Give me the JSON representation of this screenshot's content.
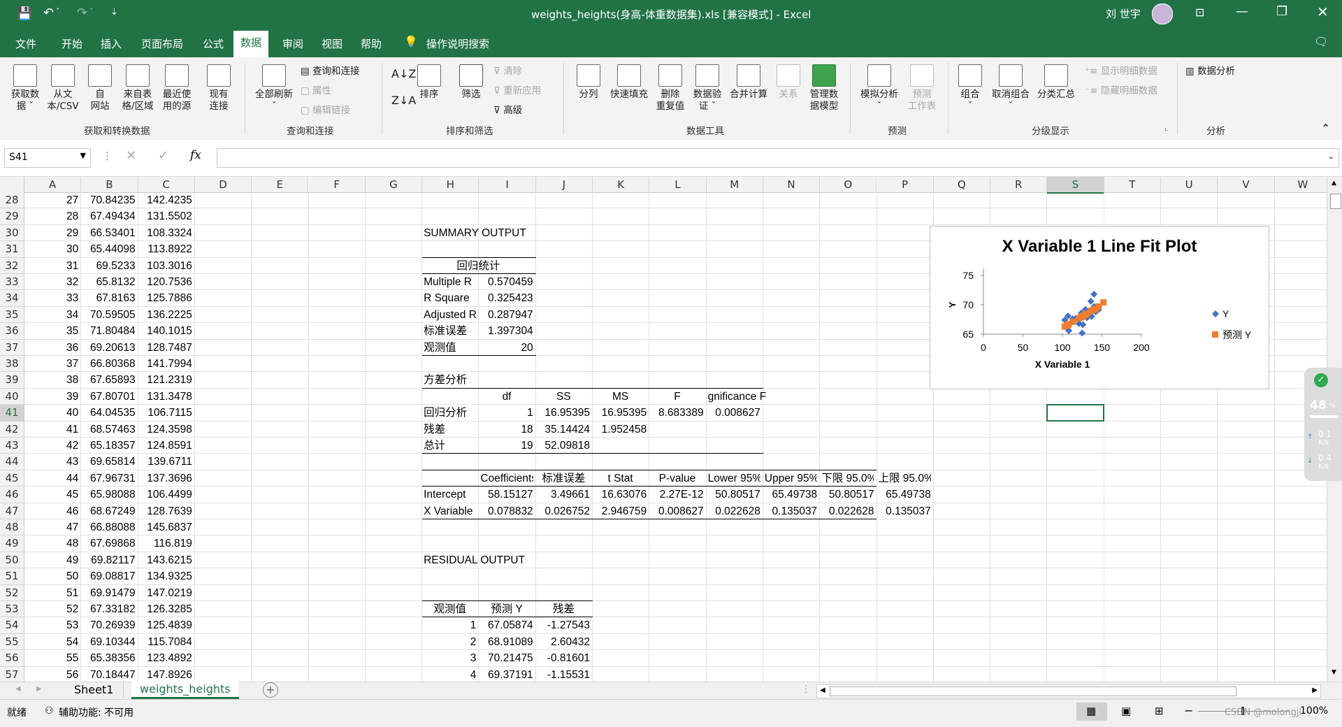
{
  "titlebar": {
    "title": "weights_heights(身高-体重数据集).xls  [兼容模式]  -  Excel",
    "user": "刘 世宇",
    "quick_more": "⇣"
  },
  "ribbon_tabs": [
    "文件",
    "开始",
    "插入",
    "页面布局",
    "公式",
    "数据",
    "审阅",
    "视图",
    "帮助"
  ],
  "active_tab": "数据",
  "tell_me": "操作说明搜索",
  "ribbon": {
    "get_data": [
      "获取数",
      "据 ˇ"
    ],
    "from_text": [
      "从文",
      "本/CSV"
    ],
    "from_web": [
      "自",
      "网站"
    ],
    "from_table": [
      "来自表",
      "格/区域"
    ],
    "recent": [
      "最近使",
      "用的源"
    ],
    "existing": [
      "现有",
      "连接"
    ],
    "group_get": "获取和转换数据",
    "refresh_all": [
      "全部刷新",
      "ˇ"
    ],
    "query_conn": "查询和连接",
    "properties": "属性",
    "edit_links": "编辑链接",
    "group_query": "查询和连接",
    "sort": "排序",
    "filter": "筛选",
    "clear": "清除",
    "reapply": "重新应用",
    "advanced": "高级",
    "group_sort": "排序和筛选",
    "text_to_col": "分列",
    "flash_fill": "快速填充",
    "remove_dup": [
      "删除",
      "重复值"
    ],
    "validation": [
      "数据验",
      "证 ˇ"
    ],
    "consolidate": "合并计算",
    "relations": "关系",
    "data_model": [
      "管理数",
      "据模型"
    ],
    "group_tools": "数据工具",
    "what_if": [
      "模拟分析",
      "ˇ"
    ],
    "forecast": [
      "预测",
      "工作表"
    ],
    "group_forecast": "预测",
    "group_btn": [
      "组合",
      "ˇ"
    ],
    "ungroup": [
      "取消组合",
      "ˇ"
    ],
    "subtotal": "分类汇总",
    "show_detail": "显示明细数据",
    "hide_detail": "隐藏明细数据",
    "group_outline": "分级显示",
    "data_analysis": "数据分析",
    "group_analysis": "分析"
  },
  "formula_bar": {
    "name_box": "S41",
    "fx": "fx",
    "value": ""
  },
  "columns": [
    "A",
    "B",
    "C",
    "D",
    "E",
    "F",
    "G",
    "H",
    "I",
    "J",
    "K",
    "L",
    "M",
    "N",
    "O",
    "P",
    "Q",
    "R",
    "S",
    "T",
    "U",
    "V",
    "W"
  ],
  "selected_column": "S",
  "selected_row": "41",
  "rows": [
    "28",
    "29",
    "30",
    "31",
    "32",
    "33",
    "34",
    "35",
    "36",
    "37",
    "38",
    "39",
    "40",
    "41",
    "42",
    "43",
    "44",
    "45",
    "46",
    "47",
    "48",
    "49",
    "50",
    "51",
    "52",
    "53",
    "54",
    "55",
    "56",
    "57"
  ],
  "data_a": [
    "27",
    "28",
    "29",
    "30",
    "31",
    "32",
    "33",
    "34",
    "35",
    "36",
    "37",
    "38",
    "39",
    "40",
    "41",
    "42",
    "43",
    "44",
    "45",
    "46",
    "47",
    "48",
    "49",
    "50",
    "51",
    "52",
    "53",
    "54",
    "55",
    "56"
  ],
  "data_b": [
    "70.84235",
    "67.49434",
    "66.53401",
    "65.44098",
    "69.5233",
    "65.8132",
    "67.8163",
    "70.59505",
    "71.80484",
    "69.20613",
    "66.80368",
    "67.65893",
    "67.80701",
    "64.04535",
    "68.57463",
    "65.18357",
    "69.65814",
    "67.96731",
    "65.98088",
    "68.67249",
    "66.88088",
    "67.69868",
    "69.82117",
    "69.08817",
    "69.91479",
    "67.33182",
    "70.26939",
    "69.10344",
    "65.38356",
    "70.18447"
  ],
  "data_c": [
    "142.4235",
    "131.5502",
    "108.3324",
    "113.8922",
    "103.3016",
    "120.7536",
    "125.7886",
    "136.2225",
    "140.1015",
    "128.7487",
    "141.7994",
    "121.2319",
    "131.3478",
    "106.7115",
    "124.3598",
    "124.8591",
    "139.6711",
    "137.3696",
    "106.4499",
    "128.7639",
    "145.6837",
    "116.819",
    "143.6215",
    "134.9325",
    "147.0219",
    "126.3285",
    "125.4839",
    "115.7084",
    "123.4892",
    "147.8926"
  ],
  "summary": {
    "title": "SUMMARY OUTPUT",
    "reg_stats": "回归统计",
    "labels": [
      "Multiple R",
      "R Square",
      "Adjusted R",
      "标准误差",
      "观测值"
    ],
    "values": [
      "0.570459",
      "0.325423",
      "0.287947",
      "1.397304",
      "20"
    ],
    "anova_title": "方差分析",
    "anova_headers": [
      "df",
      "SS",
      "MS",
      "F",
      "gnificance F"
    ],
    "anova_rows": [
      {
        "label": "回归分析",
        "df": "1",
        "ss": "16.95395",
        "ms": "16.95395",
        "f": "8.683389",
        "sig": "0.008627"
      },
      {
        "label": "残差",
        "df": "18",
        "ss": "35.14424",
        "ms": "1.952458",
        "f": "",
        "sig": ""
      },
      {
        "label": "总计",
        "df": "19",
        "ss": "52.09818",
        "ms": "",
        "f": "",
        "sig": ""
      }
    ],
    "coef_headers": [
      "Coefficients",
      "标准误差",
      "t Stat",
      "P-value",
      "Lower 95%",
      "Upper 95%",
      "下限 95.0%",
      "上限 95.0%"
    ],
    "coef_rows": [
      {
        "label": "Intercept",
        "vals": [
          "58.15127",
          "3.49661",
          "16.63076",
          "2.27E-12",
          "50.80517",
          "65.49738",
          "50.80517",
          "65.49738"
        ]
      },
      {
        "label": "X Variable",
        "vals": [
          "0.078832",
          "0.026752",
          "2.946759",
          "0.008627",
          "0.022628",
          "0.135037",
          "0.022628",
          "0.135037"
        ]
      }
    ],
    "residual_title": "RESIDUAL OUTPUT",
    "residual_headers": [
      "观测值",
      "预测 Y",
      "残差"
    ],
    "residual_rows": [
      [
        "1",
        "67.05874",
        "-1.27543"
      ],
      [
        "2",
        "68.91089",
        "2.60432"
      ],
      [
        "3",
        "70.21475",
        "-0.81601"
      ],
      [
        "4",
        "69.37191",
        "-1.15531"
      ]
    ]
  },
  "chart_data": {
    "type": "scatter",
    "title": "X Variable 1 Line Fit  Plot",
    "xlabel": "X Variable 1",
    "ylabel": "Y",
    "xlim": [
      0,
      200
    ],
    "ylim": [
      65,
      75
    ],
    "x_ticks": [
      "0",
      "50",
      "100",
      "150",
      "200"
    ],
    "y_ticks": [
      "65",
      "70",
      "75"
    ],
    "legend_position": "right",
    "series": [
      {
        "name": "Y",
        "color": "#4472c4",
        "marker": "diamond",
        "points": [
          [
            108,
            65.6
          ],
          [
            113,
            67.6
          ],
          [
            103,
            67.4
          ],
          [
            121,
            66.8
          ],
          [
            126,
            66.6
          ],
          [
            136,
            70.6
          ],
          [
            140,
            71.8
          ],
          [
            129,
            69.2
          ],
          [
            142,
            68.8
          ],
          [
            121,
            67.4
          ],
          [
            131,
            67.8
          ],
          [
            107,
            68.1
          ],
          [
            124,
            68.6
          ],
          [
            125,
            65.2
          ],
          [
            140,
            69.7
          ],
          [
            137,
            68.0
          ],
          [
            106,
            66.0
          ],
          [
            129,
            68.7
          ],
          [
            146,
            69.2
          ],
          [
            117,
            67.7
          ]
        ]
      },
      {
        "name": "预测 Y",
        "color": "#ed7d31",
        "marker": "square",
        "points": [
          [
            108,
            66.7
          ],
          [
            113,
            67.1
          ],
          [
            103,
            66.3
          ],
          [
            121,
            67.7
          ],
          [
            126,
            68.1
          ],
          [
            136,
            68.9
          ],
          [
            140,
            69.2
          ],
          [
            129,
            68.3
          ],
          [
            142,
            69.3
          ],
          [
            121,
            67.7
          ],
          [
            131,
            68.5
          ],
          [
            107,
            66.6
          ],
          [
            124,
            67.9
          ],
          [
            125,
            68.0
          ],
          [
            140,
            69.2
          ],
          [
            137,
            69.0
          ],
          [
            106,
            66.5
          ],
          [
            129,
            68.3
          ],
          [
            146,
            69.7
          ],
          [
            152,
            70.4
          ]
        ]
      }
    ]
  },
  "sheet_tabs": [
    "Sheet1",
    "weights_heights"
  ],
  "active_sheet": "weights_heights",
  "status": {
    "ready": "就绪",
    "accessibility": "辅助功能: 不可用",
    "zoom": "100%",
    "watermark": "CSDN @molongji"
  },
  "side_widget": {
    "pct": "48",
    "pct_unit": "%",
    "up": "0.1",
    "down": "0.4",
    "unit": "K/s"
  }
}
